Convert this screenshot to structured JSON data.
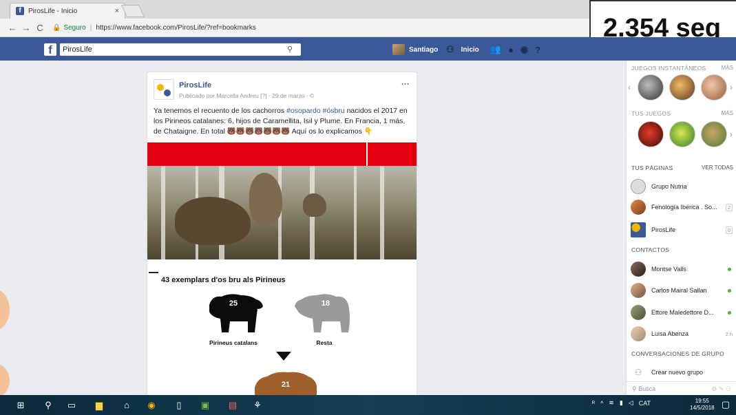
{
  "browser": {
    "tab_title": "PirosLife - Inicio",
    "tab_close": "×",
    "nav_back": "←",
    "nav_forward": "→",
    "nav_reload": "C",
    "secure_label": "Seguro",
    "url": "https://www.facebook.com/PirosLife/?ref=bookmarks"
  },
  "overlay": {
    "timer_text": "2.354 seg"
  },
  "fb_header": {
    "logo": "f",
    "search_value": "PirosLife",
    "user_name": "Santiago",
    "home_label": "Inicio"
  },
  "post": {
    "page_name": "PirosLife",
    "meta": "Publicado por Marcella Andreu [?] · 29 de marzo · ©",
    "menu": "···",
    "text_1": "Ya tenemos el recuento de los cachorros ",
    "tag_1": "#osopardo",
    "tag_2": "#ósbru",
    "text_2": " nacidos el 2017 en los Pirineos catalanes: 6, hijos de Caramellita, Isil y Plume. En Francia, 1 más, de Chataigne. En total 🐻🐻🐻🐻🐻🐻🐻 Aquí os lo explicamos 👇",
    "infographic": {
      "title": "43 exemplars d'os bru als Pirineus",
      "bear_1_num": "25",
      "bear_1_label": "Pirineus catalans",
      "bear_2_num": "18",
      "bear_2_label": "Resta",
      "bear_3_num": "21"
    }
  },
  "sidebar": {
    "games_head": "JUEGOS INSTANTÁNEOS",
    "games_more": "MÁS",
    "your_games_head": "TUS JUEGOS",
    "your_games_more": "MÁS",
    "pages_head": "TUS PÁGINAS",
    "pages_more": "VER TODAS",
    "pages": [
      {
        "name": "Grupo Nutria",
        "count": ""
      },
      {
        "name": "Fenología Ibérica . So...",
        "count": "2"
      },
      {
        "name": "PirosLife",
        "count": "0"
      }
    ],
    "contacts_head": "CONTACTOS",
    "contacts": [
      {
        "name": "Montse Valls",
        "status": ""
      },
      {
        "name": "Carlos Mairal Sallan",
        "status": ""
      },
      {
        "name": "Ettore Maledettore D...",
        "status": ""
      },
      {
        "name": "Luisa Abenza",
        "status": "2 h"
      }
    ],
    "group_conv_head": "CONVERSACIONES DE GRUPO",
    "create_group": "Crear nuevo grupo",
    "chat_search": "Busca"
  },
  "taskbar": {
    "lang": "CAT",
    "time": "19:55",
    "date": "14/5/2018"
  }
}
